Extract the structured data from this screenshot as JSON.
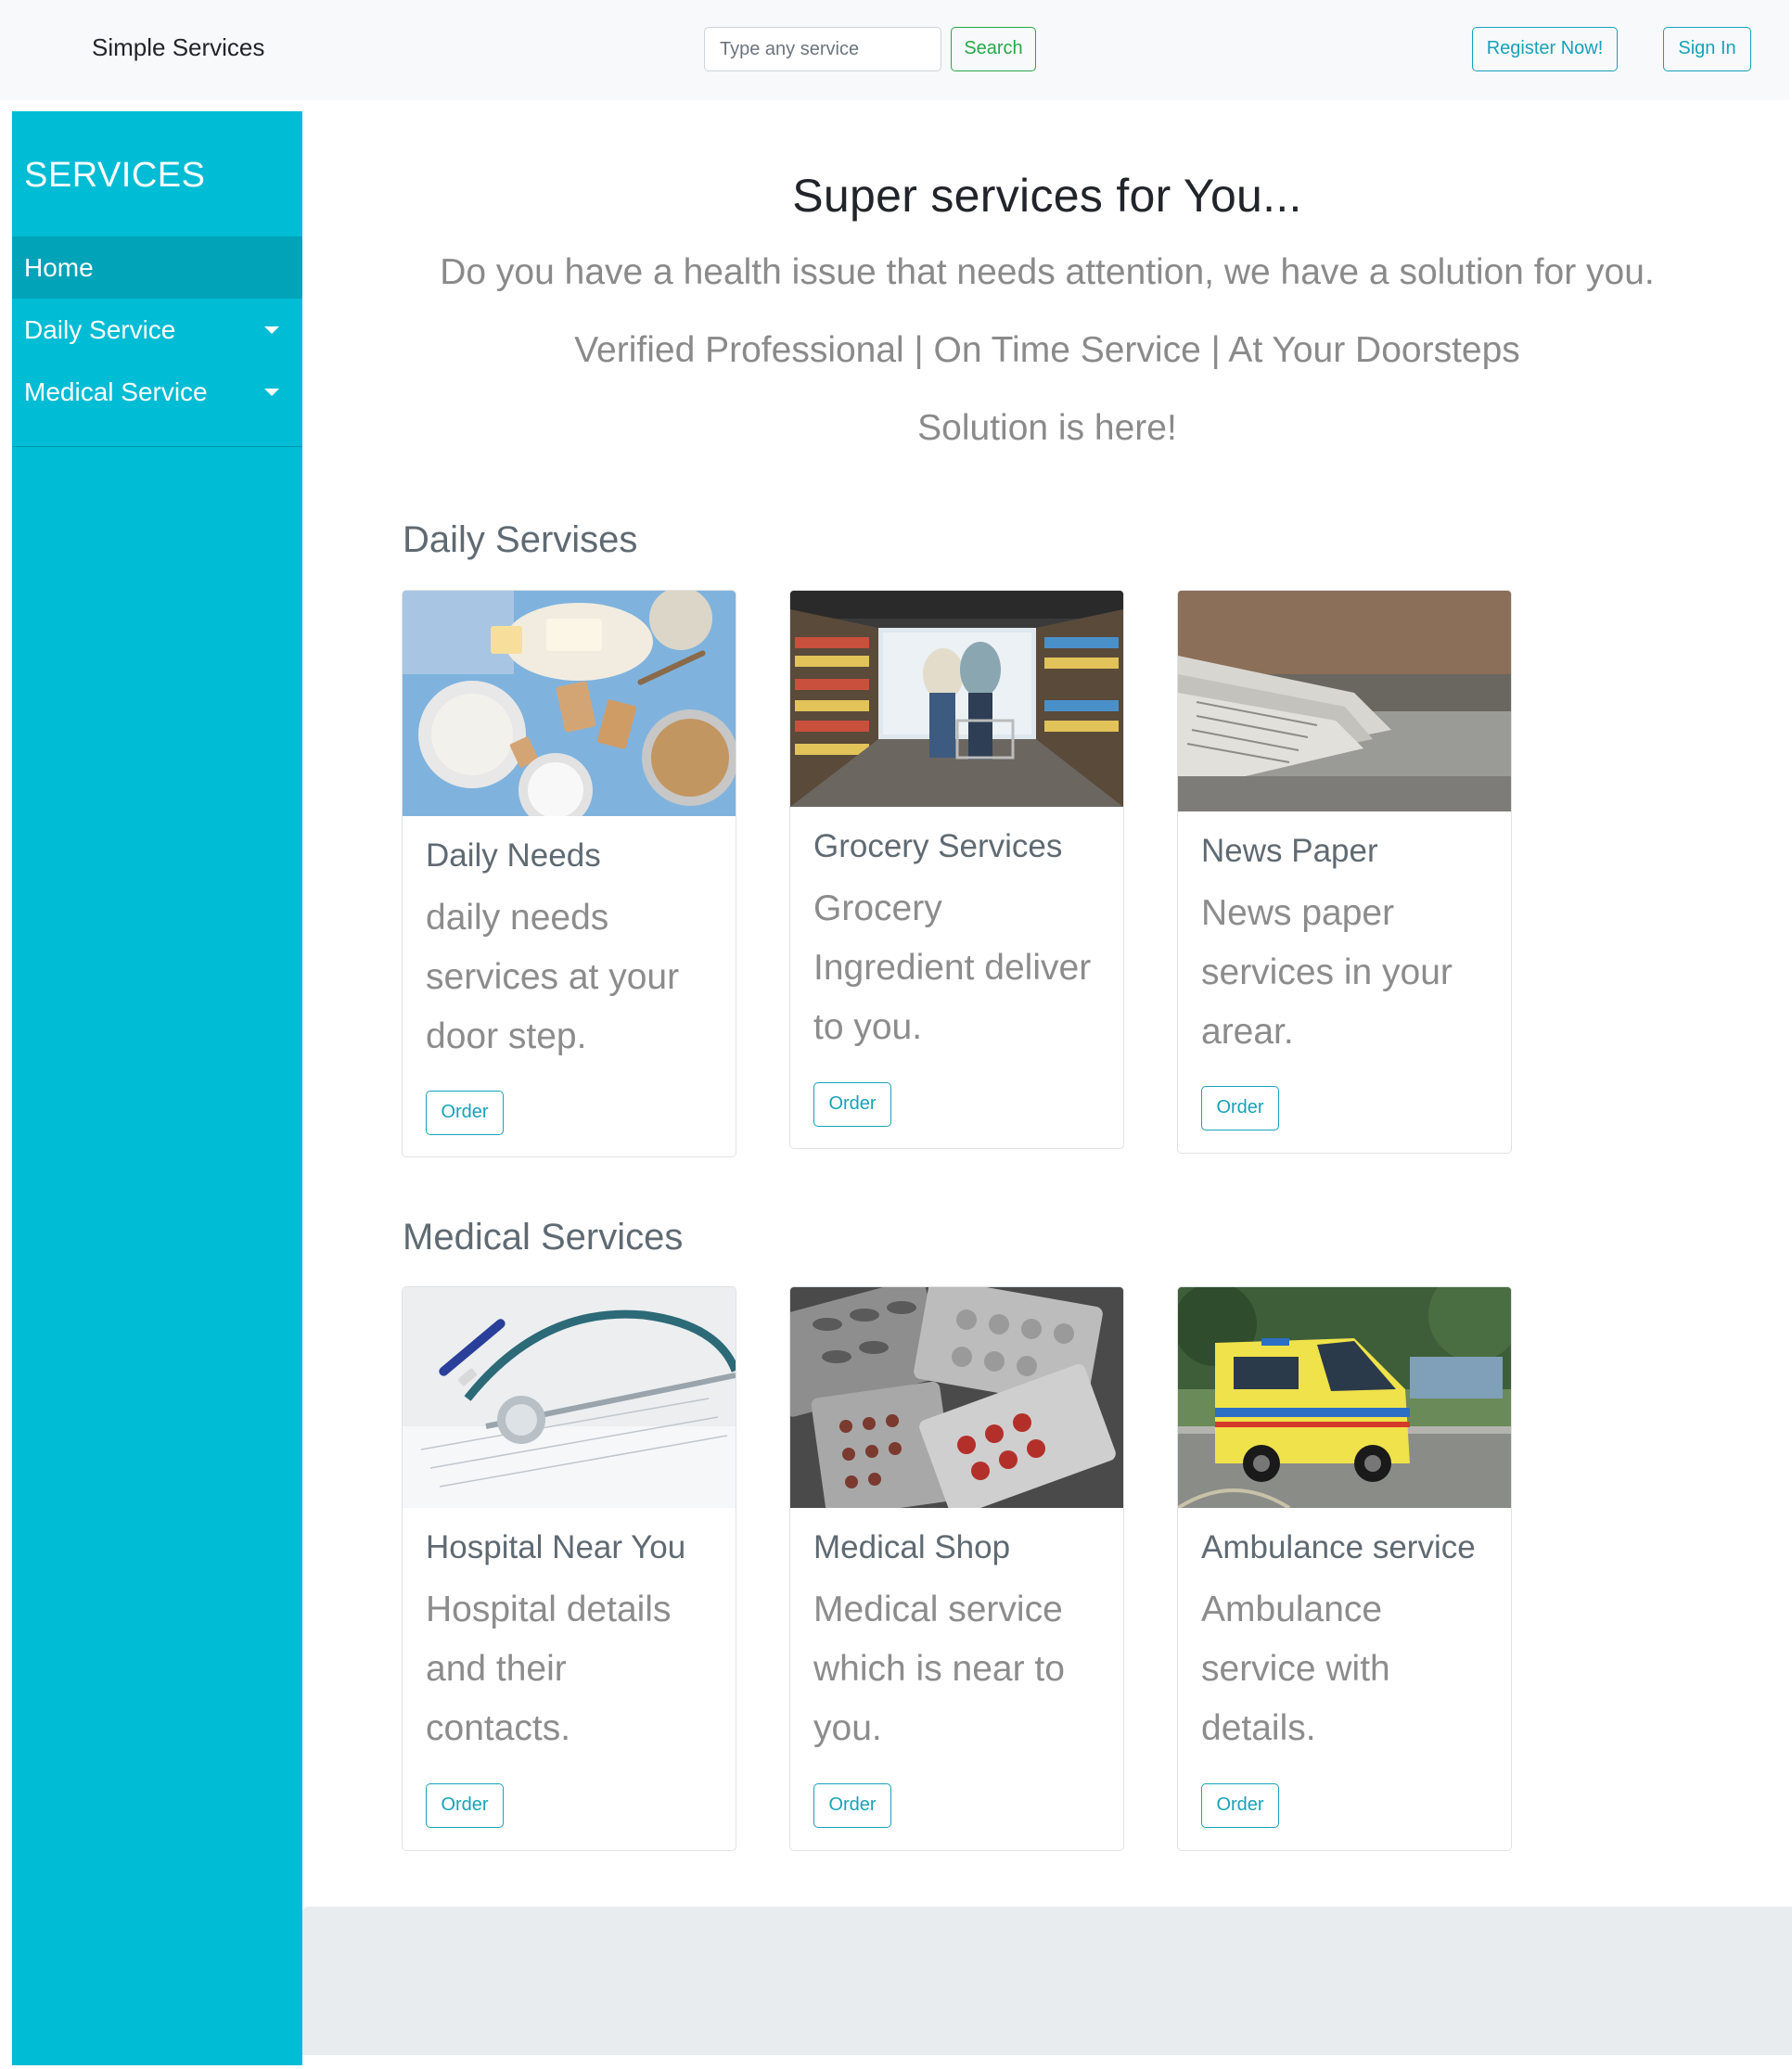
{
  "navbar": {
    "brand": "Simple Services",
    "search": {
      "placeholder": "Type any service",
      "value": "",
      "button_label": "Search"
    },
    "register_label": "Register Now!",
    "signin_label": "Sign In"
  },
  "sidebar": {
    "title": "SERVICES",
    "items": [
      {
        "label": "Home",
        "active": true,
        "has_dropdown": false
      },
      {
        "label": "Daily Service",
        "active": false,
        "has_dropdown": true
      },
      {
        "label": "Medical Service",
        "active": false,
        "has_dropdown": true
      }
    ],
    "background_color": "#00bcd4"
  },
  "hero": {
    "title": "Super services for You...",
    "line1": "Do you have a health issue that needs attention, we have a solution for you.",
    "line2": "Verified Professional | On Time Service | At Your Doorsteps",
    "line3": "Solution is here!"
  },
  "daily_section": {
    "title": "Daily Servises",
    "cards": [
      {
        "title": "Daily Needs",
        "text": "daily needs services at your door step.",
        "button": "Order",
        "image": "baking ingredients flat-lay photo"
      },
      {
        "title": "Grocery Services",
        "text": "Grocery Ingredient deliver to you.",
        "button": "Order",
        "image": "couple shopping in supermarket aisle photo"
      },
      {
        "title": "News Paper",
        "text": "News paper services in your arear.",
        "button": "Order",
        "image": "stack of newspapers photo"
      }
    ]
  },
  "medical_section": {
    "title": "Medical Services",
    "cards": [
      {
        "title": "Hospital Near You",
        "text": "Hospital details and their contacts.",
        "button": "Order",
        "image": "stethoscope and pen on medical form photo"
      },
      {
        "title": "Medical Shop",
        "text": "Medical service which is near to you.",
        "button": "Order",
        "image": "blister packs of pills photo"
      },
      {
        "title": "Ambulance service",
        "text": "Ambulance service with details.",
        "button": "Order",
        "image": "yellow ambulance van on street photo"
      }
    ]
  },
  "colors": {
    "accent_info": "#17a2b8",
    "accent_success": "#28a745",
    "navbar_bg": "#f8f9fa",
    "footer_bg": "#e9ecef"
  }
}
